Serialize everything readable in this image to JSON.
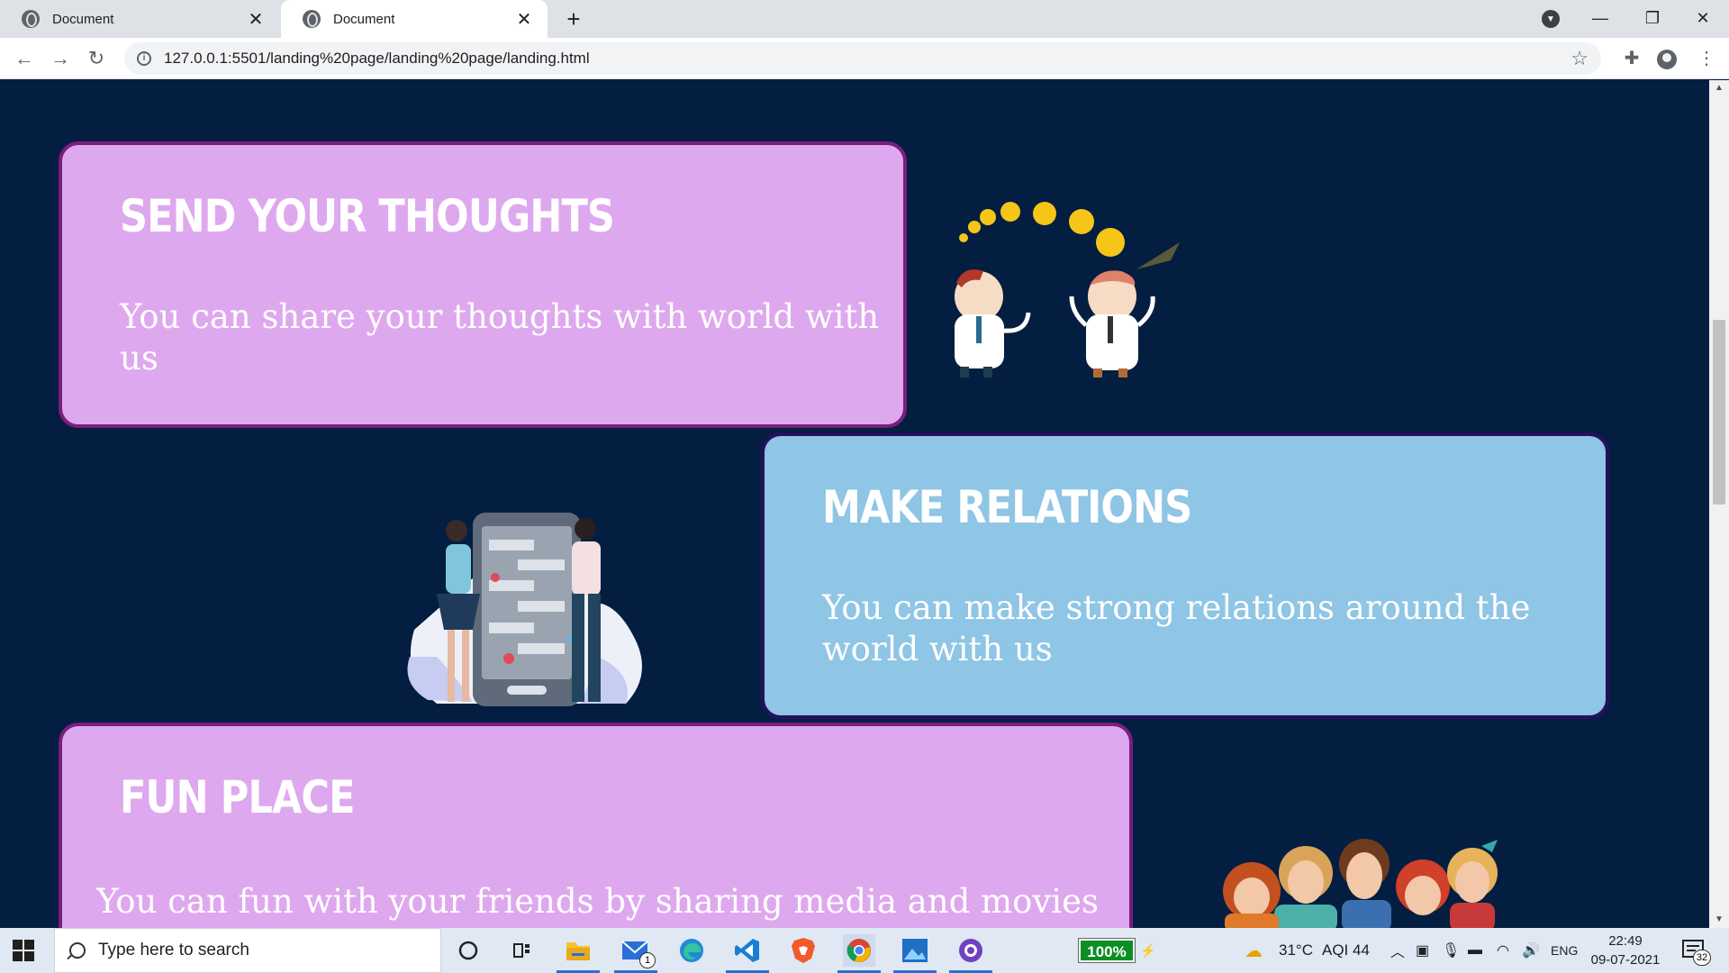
{
  "browser": {
    "tabs": [
      {
        "title": "Document",
        "active": false
      },
      {
        "title": "Document",
        "active": true
      }
    ],
    "new_tab_symbol": "+",
    "url": "127.0.0.1:5501/landing%20page/landing%20page/landing.html"
  },
  "cards": [
    {
      "title": "SEND YOUR THOUGHTS",
      "text": "You can share your thoughts with world with us",
      "color": "#dea8ee"
    },
    {
      "title": "MAKE RELATIONS",
      "text": "You can make strong relations around the world with us",
      "color": "#8fc5e5"
    },
    {
      "title": "FUN PLACE",
      "text": "You can fun with your friends by sharing media and movies",
      "color": "#dea8ee"
    }
  ],
  "page_background": "#041e42",
  "taskbar": {
    "search_placeholder": "Type here to search",
    "mail_badge": "1",
    "battery": "100%",
    "weather": "31°C",
    "aqi": "AQI 44",
    "language": "ENG",
    "time": "22:49",
    "date": "09-07-2021",
    "notifications": "32"
  }
}
